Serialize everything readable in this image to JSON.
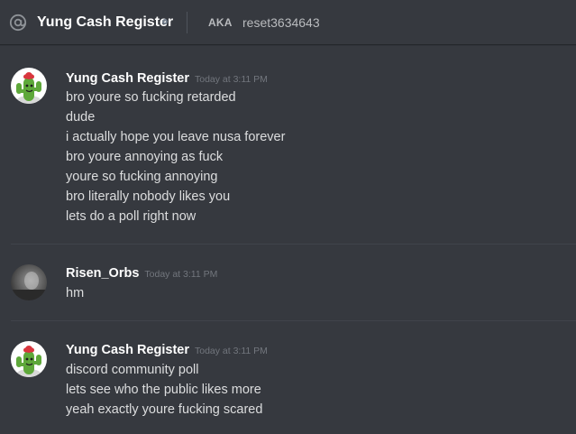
{
  "header": {
    "title": "Yung Cash Register",
    "aka_label": "AKA",
    "aka_value": "reset3634643"
  },
  "messages": [
    {
      "author": "Yung Cash Register",
      "timestamp": "Today at 3:11 PM",
      "avatar": "cactus-avatar",
      "lines": [
        "bro youre so fucking retarded",
        "dude",
        "i actually hope you leave nusa forever",
        "bro youre annoying as fuck",
        "youre so fucking annoying",
        "bro literally nobody likes you",
        "lets do a poll right now"
      ]
    },
    {
      "author": "Risen_Orbs",
      "timestamp": "Today at 3:11 PM",
      "avatar": "photo-avatar",
      "lines": [
        "hm"
      ]
    },
    {
      "author": "Yung Cash Register",
      "timestamp": "Today at 3:11 PM",
      "avatar": "cactus-avatar",
      "lines": [
        "discord community poll",
        "lets see who the public likes more",
        "yeah exactly youre fucking scared"
      ]
    }
  ],
  "colors": {
    "background": "#36393f",
    "username": "#ffffff",
    "message_text": "#dcddde",
    "timestamp": "#72767d",
    "separator": "#40444b"
  }
}
